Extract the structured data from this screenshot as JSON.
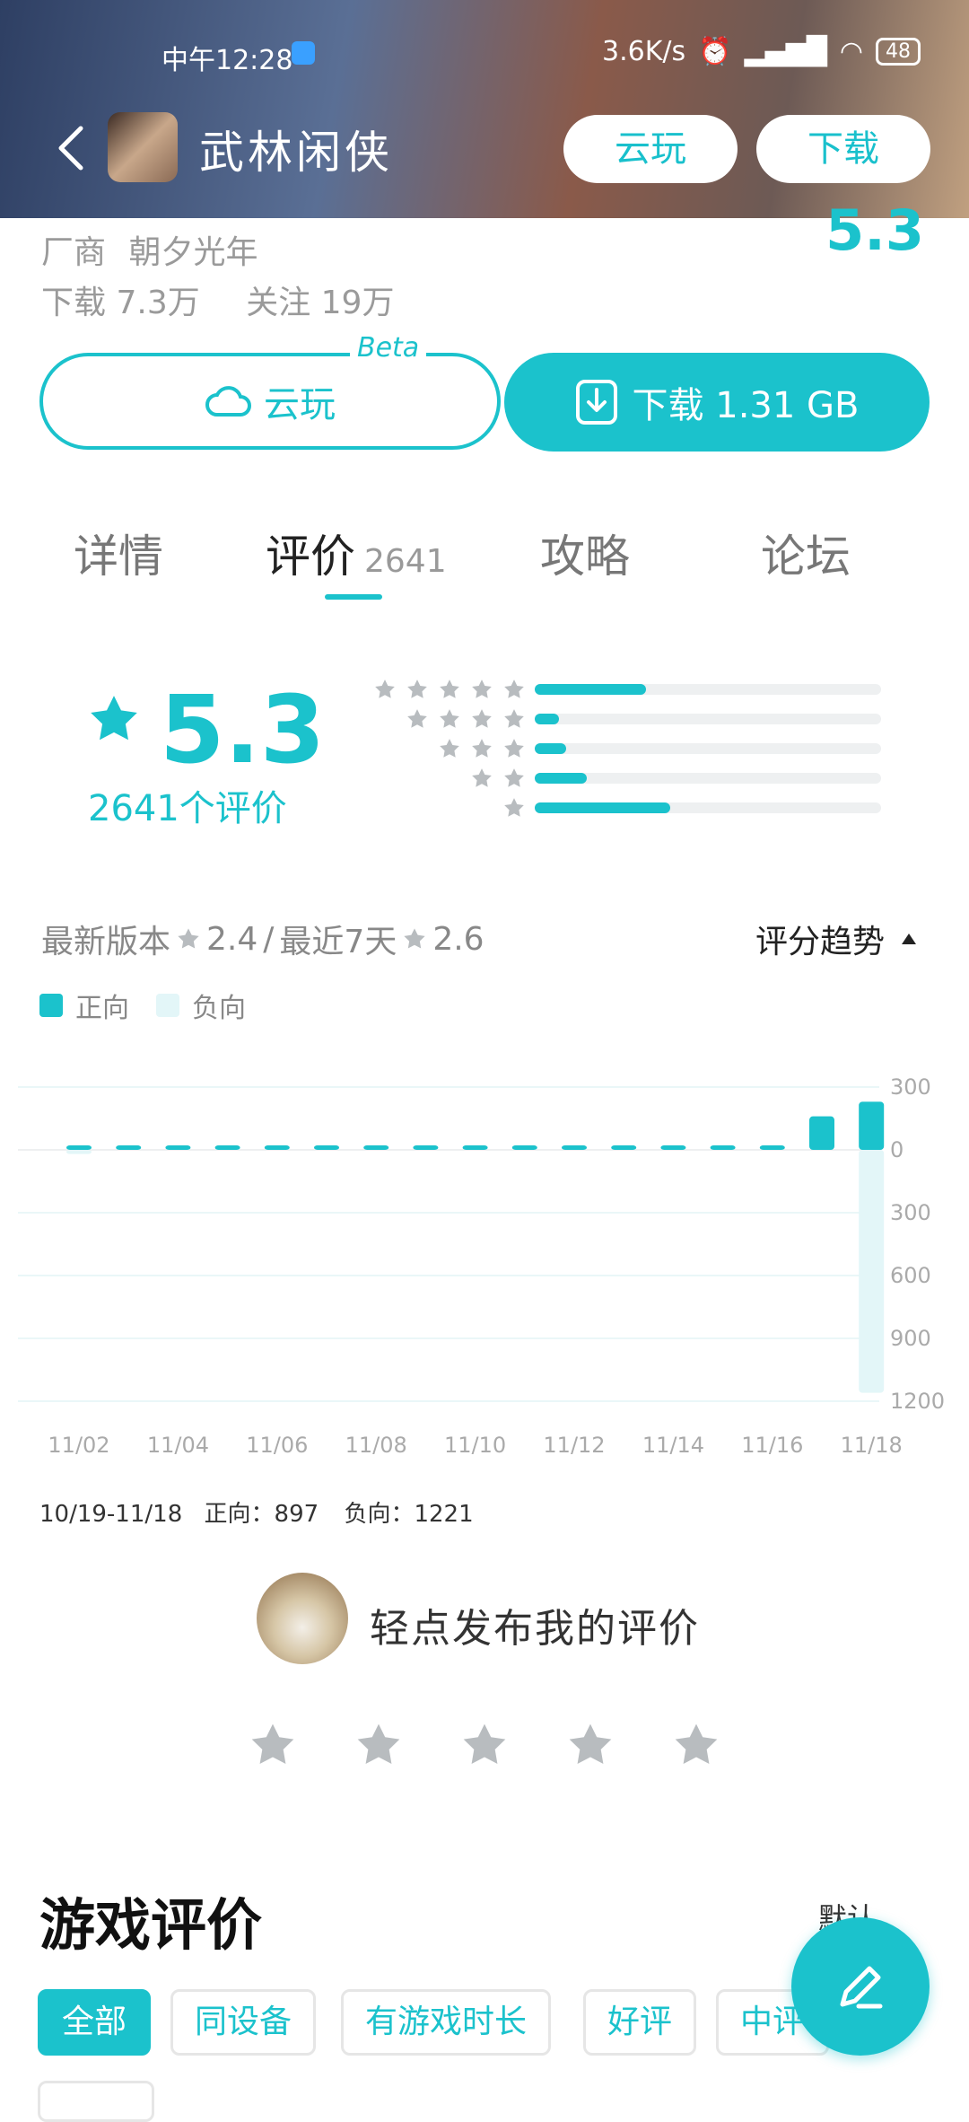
{
  "status_bar": {
    "time": "中午12:28",
    "speed": "3.6K/s",
    "battery": "48"
  },
  "header": {
    "title": "武林闲侠",
    "cloud_play": "云玩",
    "download": "下载"
  },
  "info": {
    "vendor_label": "厂商",
    "vendor": "朝夕光年",
    "downloads_label": "下载",
    "downloads": "7.3万",
    "follows_label": "关注",
    "follows": "19万",
    "score": "5.3"
  },
  "actions": {
    "cloud_play": "云玩",
    "beta": "Beta",
    "download": "下载 1.31 GB"
  },
  "tabs": [
    {
      "label": "详情"
    },
    {
      "label": "评价",
      "count": "2641"
    },
    {
      "label": "攻略"
    },
    {
      "label": "论坛"
    }
  ],
  "rating": {
    "value": "5.3",
    "count_text": "2641个评价",
    "distribution": [
      {
        "stars": 5,
        "fraction": 0.32
      },
      {
        "stars": 4,
        "fraction": 0.07
      },
      {
        "stars": 3,
        "fraction": 0.09
      },
      {
        "stars": 2,
        "fraction": 0.15
      },
      {
        "stars": 1,
        "fraction": 0.39
      }
    ]
  },
  "trend": {
    "latest_label": "最新版本",
    "latest_score": "2.4",
    "sep": "/",
    "recent_label": "最近7天",
    "recent_score": "2.6",
    "toggle": "评分趋势"
  },
  "legend": {
    "positive": "正向",
    "negative": "负向"
  },
  "colors": {
    "accent": "#1bc2cc",
    "negative": "#e3f6f8",
    "star_gray": "#b8bcbf"
  },
  "chart_data": {
    "type": "bar",
    "categories": [
      "11/02",
      "11/03",
      "11/04",
      "11/05",
      "11/06",
      "11/07",
      "11/08",
      "11/09",
      "11/10",
      "11/11",
      "11/12",
      "11/13",
      "11/14",
      "11/15",
      "11/16",
      "11/17",
      "11/18"
    ],
    "x_tick_labels": [
      "11/02",
      "11/04",
      "11/06",
      "11/08",
      "11/10",
      "11/12",
      "11/14",
      "11/16",
      "11/18"
    ],
    "series": [
      {
        "name": "正向",
        "values": [
          2,
          8,
          3,
          3,
          3,
          3,
          3,
          3,
          3,
          3,
          3,
          3,
          5,
          5,
          5,
          160,
          230
        ]
      },
      {
        "name": "负向",
        "values": [
          -20,
          0,
          0,
          0,
          0,
          0,
          0,
          0,
          0,
          0,
          0,
          0,
          0,
          0,
          0,
          0,
          -1160
        ]
      }
    ],
    "y_tick_labels": [
      "300",
      "0",
      "300",
      "600",
      "900",
      "1200"
    ],
    "ylim": [
      -1200,
      300
    ],
    "grid": true
  },
  "summary": {
    "range": "10/19-11/18",
    "pos_label": "正向：",
    "pos": "897",
    "neg_label": "负向：",
    "neg": "1221"
  },
  "compose": {
    "prompt": "轻点发布我的评价"
  },
  "reviews": {
    "title": "游戏评价",
    "sort": "默认",
    "filters": [
      "全部",
      "同设备",
      "有游戏时长",
      "好评",
      "中评"
    ]
  }
}
